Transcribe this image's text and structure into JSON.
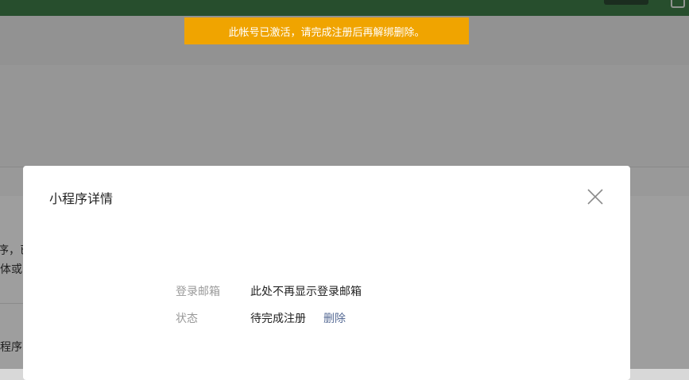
{
  "banner": {
    "text": "此帐号已激活，请完成注册后再解绑删除。",
    "color": "#f0a400"
  },
  "background": {
    "left_fragments": [
      "序，已",
      "体或",
      "程序"
    ]
  },
  "modal": {
    "title": "小程序详情",
    "close_icon": "close-icon",
    "rows": [
      {
        "label": "登录邮箱",
        "value": "此处不再显示登录邮箱"
      },
      {
        "label": "状态",
        "value": "待完成注册",
        "action": "删除"
      }
    ]
  },
  "colors": {
    "topbar": "#3f7f4a",
    "link": "#576b95"
  }
}
